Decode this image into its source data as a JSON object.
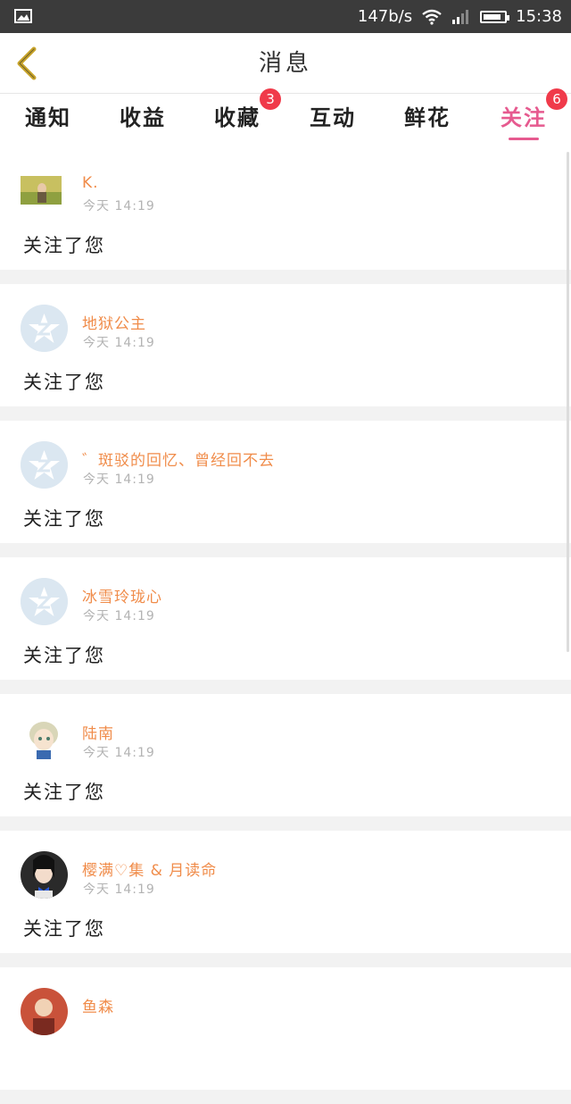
{
  "status_bar": {
    "net_speed": "147b/s",
    "time": "15:38",
    "battery_level": 0.85
  },
  "header": {
    "title": "消息"
  },
  "tabs": [
    {
      "label": "通知",
      "badge": ""
    },
    {
      "label": "收益",
      "badge": ""
    },
    {
      "label": "收藏",
      "badge": "3"
    },
    {
      "label": "互动",
      "badge": ""
    },
    {
      "label": "鲜花",
      "badge": ""
    },
    {
      "label": "关注",
      "badge": "6"
    }
  ],
  "notifications": [
    {
      "name": "K.",
      "time": "今天 14:19",
      "message": "关注了您"
    },
    {
      "name": "地狱公主",
      "time": "今天 14:19",
      "message": "关注了您"
    },
    {
      "name": "゛斑驳的回忆、曾经回不去",
      "time": "今天 14:19",
      "message": "关注了您"
    },
    {
      "name": "冰雪玲珑心",
      "time": "今天 14:19",
      "message": "关注了您"
    },
    {
      "name": "陆南",
      "time": "今天 14:19",
      "message": "关注了您"
    },
    {
      "name": "樱满♡集 & 月读命",
      "time": "今天 14:19",
      "message": "关注了您"
    },
    {
      "name": "鱼森",
      "time": "",
      "message": ""
    }
  ],
  "colors": {
    "accent": "#e65a8f",
    "name": "#f08c4a",
    "badge": "#f03a4a",
    "back_arrow": "#c9a52c"
  }
}
